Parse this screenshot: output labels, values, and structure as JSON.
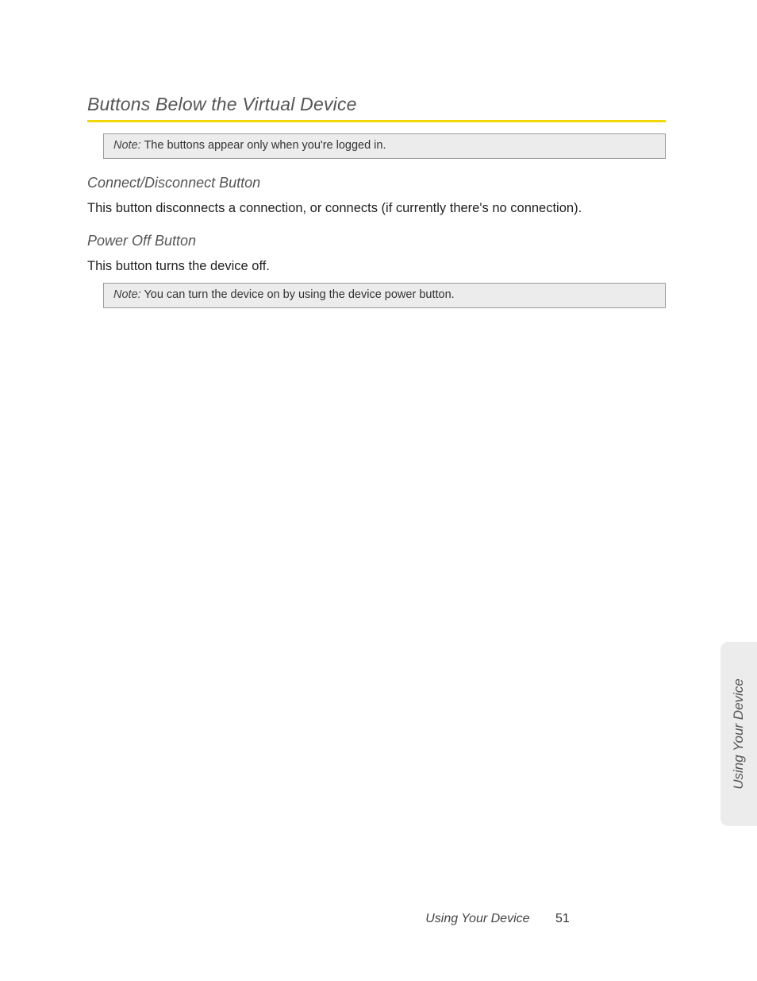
{
  "section_title": "Buttons Below the Virtual Device",
  "note1": {
    "label": "Note:",
    "text": " The buttons appear only when you're logged in."
  },
  "sub1": {
    "heading": "Connect/Disconnect Button",
    "body": "This button disconnects a connection, or connects (if currently there's no connection)."
  },
  "sub2": {
    "heading": "Power Off Button",
    "body": "This button turns the device off."
  },
  "note2": {
    "label": "Note:",
    "text": " You can turn the device on by using the device power button."
  },
  "side_tab": "Using Your Device",
  "footer": {
    "section": "Using Your Device",
    "page": "51"
  }
}
